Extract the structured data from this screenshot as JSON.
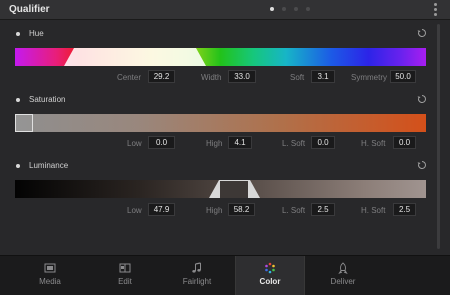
{
  "panel": {
    "title": "Qualifier",
    "page_count": 4,
    "active_page": 1
  },
  "sections": {
    "hue": {
      "label": "Hue",
      "params": [
        {
          "label": "Center",
          "value": "29.2"
        },
        {
          "label": "Width",
          "value": "33.0"
        },
        {
          "label": "Soft",
          "value": "3.1"
        },
        {
          "label": "Symmetry",
          "value": "50.0"
        }
      ]
    },
    "saturation": {
      "label": "Saturation",
      "params": [
        {
          "label": "Low",
          "value": "0.0"
        },
        {
          "label": "High",
          "value": "4.1"
        },
        {
          "label": "L. Soft",
          "value": "0.0"
        },
        {
          "label": "H. Soft",
          "value": "0.0"
        }
      ]
    },
    "luminance": {
      "label": "Luminance",
      "params": [
        {
          "label": "Low",
          "value": "47.9"
        },
        {
          "label": "High",
          "value": "58.2"
        },
        {
          "label": "L. Soft",
          "value": "2.5"
        },
        {
          "label": "H. Soft",
          "value": "2.5"
        }
      ]
    }
  },
  "tabs": [
    {
      "label": "Media",
      "icon": "media-icon"
    },
    {
      "label": "Edit",
      "icon": "edit-icon"
    },
    {
      "label": "Fairlight",
      "icon": "fairlight-icon"
    },
    {
      "label": "Color",
      "icon": "color-icon",
      "active": true
    },
    {
      "label": "Deliver",
      "icon": "deliver-icon"
    }
  ],
  "colors": {
    "panel_bg": "#28282a",
    "header_bg": "#323234",
    "active_tab_bg": "#2e2e30"
  }
}
